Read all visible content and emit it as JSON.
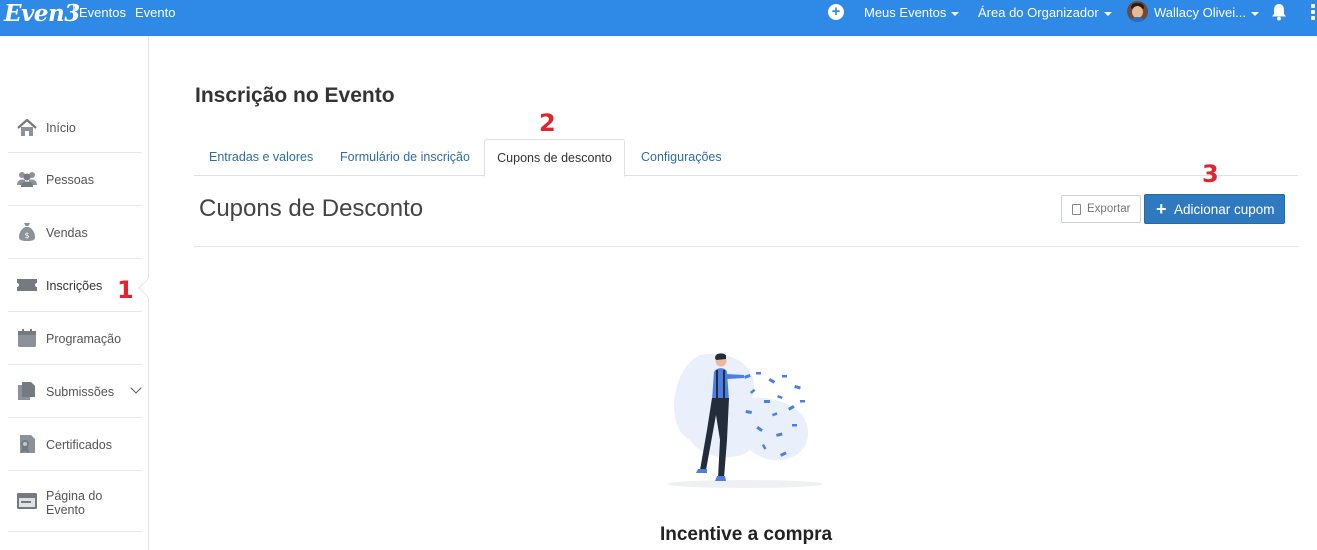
{
  "topbar": {
    "brand": "Even3",
    "links": [
      "Eventos",
      "Evento"
    ],
    "menus": {
      "meus_eventos": "Meus Eventos",
      "area_organizador": "Área do Organizador",
      "user": "Wallacy Olivei..."
    },
    "icons": [
      "plus-circle-icon",
      "bell-icon",
      "more-vertical-icon"
    ],
    "color": "#2e8ae6"
  },
  "sidebar": {
    "items": [
      {
        "label": "Início",
        "icon": "home-icon"
      },
      {
        "label": "Pessoas",
        "icon": "people-icon"
      },
      {
        "label": "Vendas",
        "icon": "money-bag-icon"
      },
      {
        "label": "Inscrições",
        "icon": "ticket-icon"
      },
      {
        "label": "Programação",
        "icon": "calendar-icon"
      },
      {
        "label": "Submissões",
        "icon": "documents-icon"
      },
      {
        "label": "Certificados",
        "icon": "certificate-icon"
      },
      {
        "label": "Página do Evento",
        "icon": "browser-window-icon"
      }
    ],
    "active": "Inscrições"
  },
  "annotations": [
    "1",
    "2",
    "3"
  ],
  "main": {
    "page_title": "Inscrição no Evento",
    "tabs": [
      "Entradas e valores",
      "Formulário de inscrição",
      "Cupons de desconto",
      "Configurações"
    ],
    "active_tab": "Cupons de desconto",
    "section_title": "Cupons de Desconto",
    "export_label": "Exportar",
    "add_label": "Adicionar cupom",
    "empty_title": "Incentive a compra"
  },
  "colors": {
    "primary_button": "#2f79be",
    "link": "#2e6da4",
    "annotation": "#e0252e"
  }
}
